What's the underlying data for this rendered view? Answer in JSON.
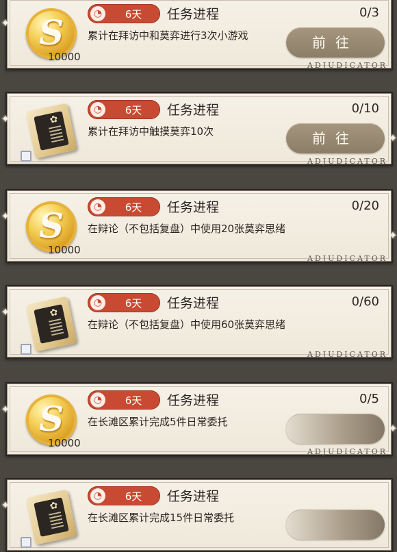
{
  "tasks": [
    {
      "timer_label": "6天",
      "title": "任务进程",
      "progress": "0/3",
      "description": "累计在拜访中和莫弈进行3次小游戏",
      "reward_type": "coin-icon",
      "reward_amount": "10000",
      "action_label": "前往"
    },
    {
      "timer_label": "6天",
      "title": "任务进程",
      "progress": "0/10",
      "description": "累计在拜访中触摸莫弈10次",
      "reward_type": "book-icon",
      "reward_amount": "",
      "action_label": "前往"
    },
    {
      "timer_label": "6天",
      "title": "任务进程",
      "progress": "0/20",
      "description": "在辩论（不包括复盘）中使用20张莫弈思绪",
      "reward_type": "coin-icon",
      "reward_amount": "10000",
      "action_label": ""
    },
    {
      "timer_label": "6天",
      "title": "任务进程",
      "progress": "0/60",
      "description": "在辩论（不包括复盘）中使用60张莫弈思绪",
      "reward_type": "book-icon",
      "reward_amount": "",
      "action_label": ""
    },
    {
      "timer_label": "6天",
      "title": "任务进程",
      "progress": "0/5",
      "description": "在长滩区累计完成5件日常委托",
      "reward_type": "coin-icon",
      "reward_amount": "10000",
      "action_label": ""
    },
    {
      "timer_label": "6天",
      "title": "任务进程",
      "progress": "",
      "description": "在长滩区累计完成15件日常委托",
      "reward_type": "book-icon",
      "reward_amount": "",
      "action_label": ""
    }
  ],
  "brand_text": "ADJUDICATOR",
  "coin_letter": "S",
  "colors": {
    "timer": "#c94a33",
    "button": "#8c7d67",
    "card": "#f3ede1"
  }
}
